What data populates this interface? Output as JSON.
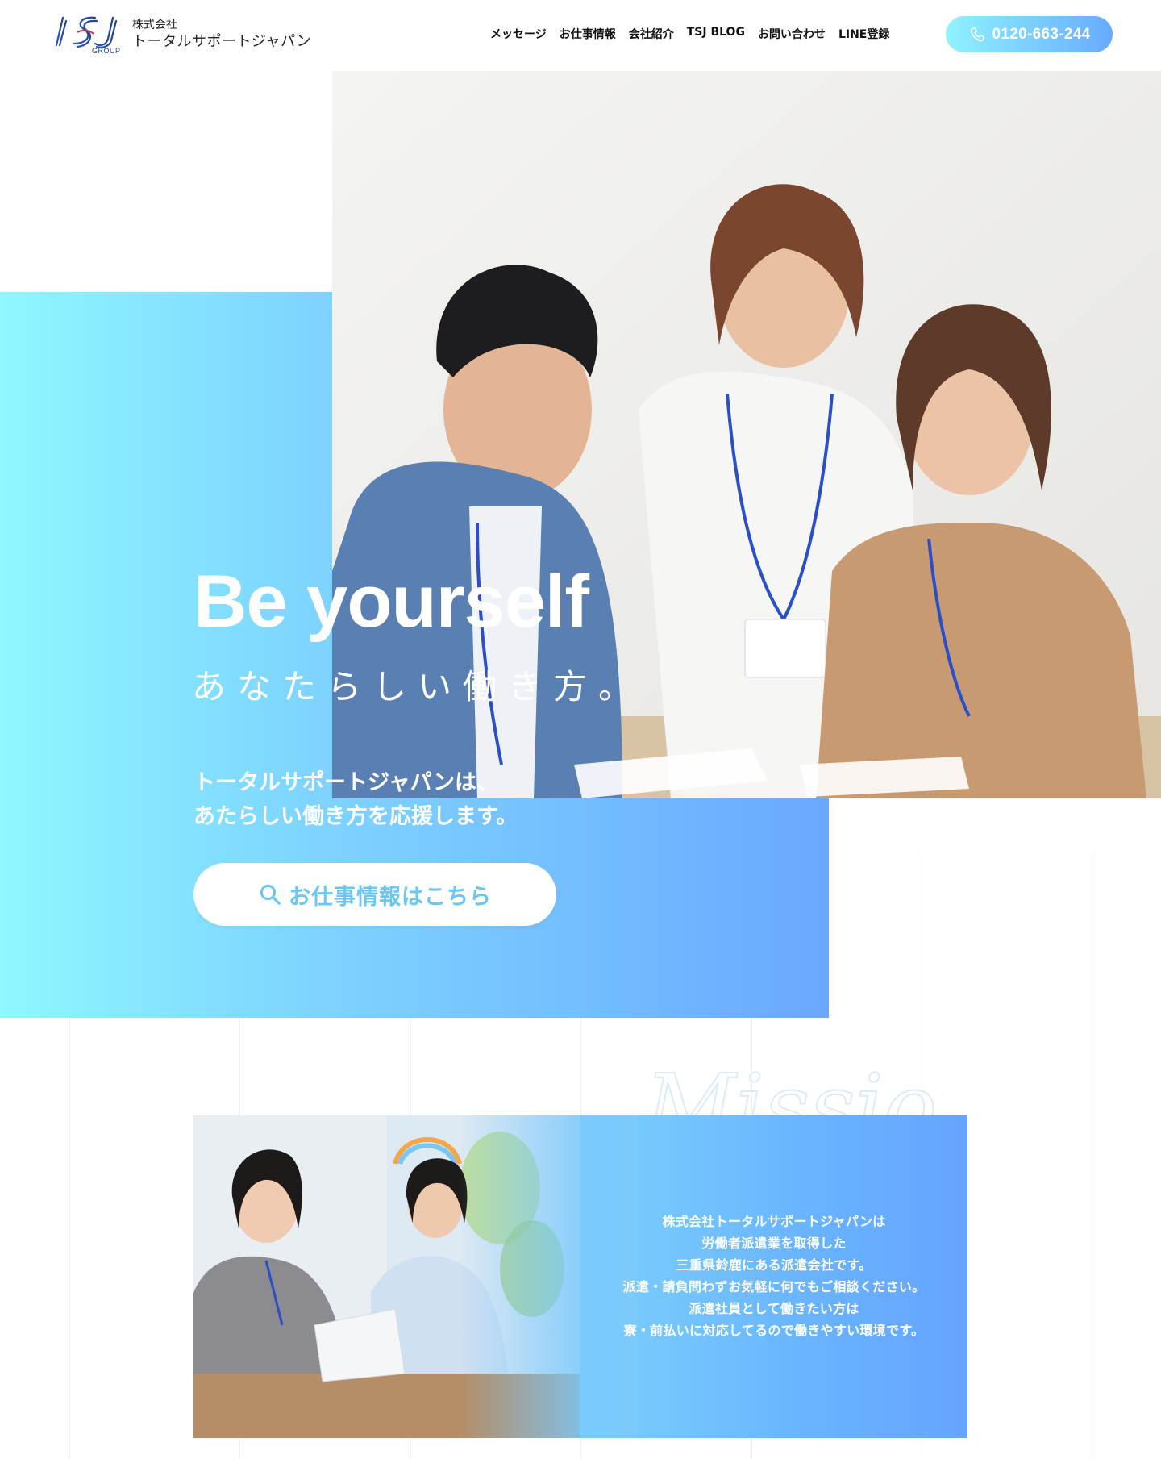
{
  "header": {
    "logo_text": "TSJ",
    "logo_group": "GROUP",
    "company_small": "株式会社",
    "company_name": "トータルサポートジャパン",
    "nav": [
      {
        "label": "メッセージ"
      },
      {
        "label": "お仕事情報"
      },
      {
        "label": "会社紹介"
      },
      {
        "label": "TSJ BLOG"
      },
      {
        "label": "お問い合わせ"
      },
      {
        "label": "LINE登録"
      }
    ],
    "phone": "0120-663-244"
  },
  "hero": {
    "title": "Be yourself",
    "subtitle": "あなたらしい働き方。",
    "text_line1": "トータルサポートジャパンは、",
    "text_line2": "あたらしい働き方を応援します。",
    "cta_label": "お仕事情報はこちら"
  },
  "mission": {
    "script_word": "Mission",
    "lines": [
      "株式会社トータルサポートジャパンは",
      "労働者派遣業を取得した",
      "三重県鈴鹿にある派遣会社です。",
      "派遣・請負問わずお気軽に何でもご相談ください。",
      "派遣社員として働きたい方は",
      "寮・前払いに対応してるので働きやすい環境です。"
    ]
  },
  "colors": {
    "gradient_start": "#8ff7ff",
    "gradient_end": "#6aa8ff",
    "accent_text": "#6bc6f2",
    "logo_blue": "#1f3f8f"
  },
  "icons": {
    "phone": "phone-icon",
    "search": "search-icon"
  }
}
